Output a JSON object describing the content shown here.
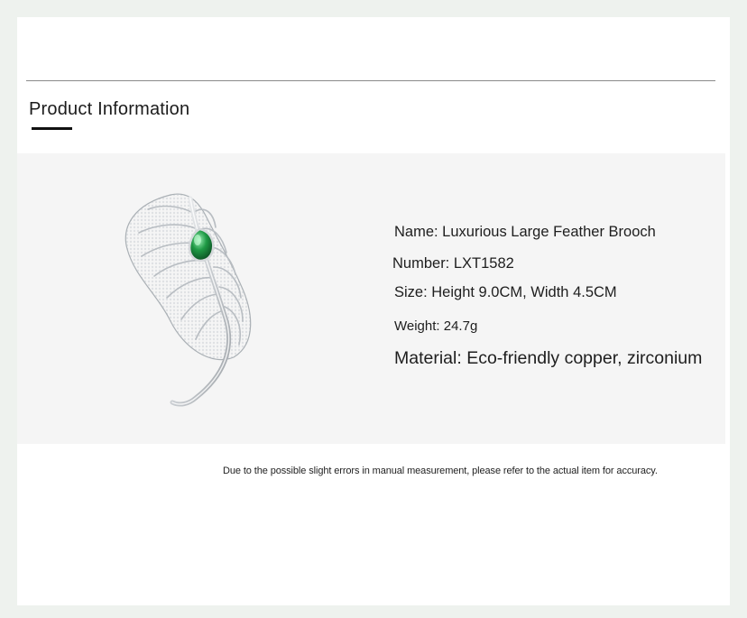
{
  "section": {
    "title": "Product Information"
  },
  "product": {
    "image_alt": "feather brooch",
    "specs": {
      "name": "Name: Luxurious Large Feather Brooch",
      "number": "Number: LXT1582",
      "size": "Size: Height 9.0CM, Width 4.5CM",
      "weight": "Weight: 24.7g",
      "material": "Material: Eco-friendly copper, zirconium"
    }
  },
  "footer": {
    "disclaimer": "Due to the possible slight errors in manual measurement, please refer to the actual item for accuracy."
  },
  "colors": {
    "page_background": "#eef2ee",
    "panel_background": "#f5f5f5",
    "gem": "#1f9a45",
    "metal": "#c9cdd1"
  }
}
